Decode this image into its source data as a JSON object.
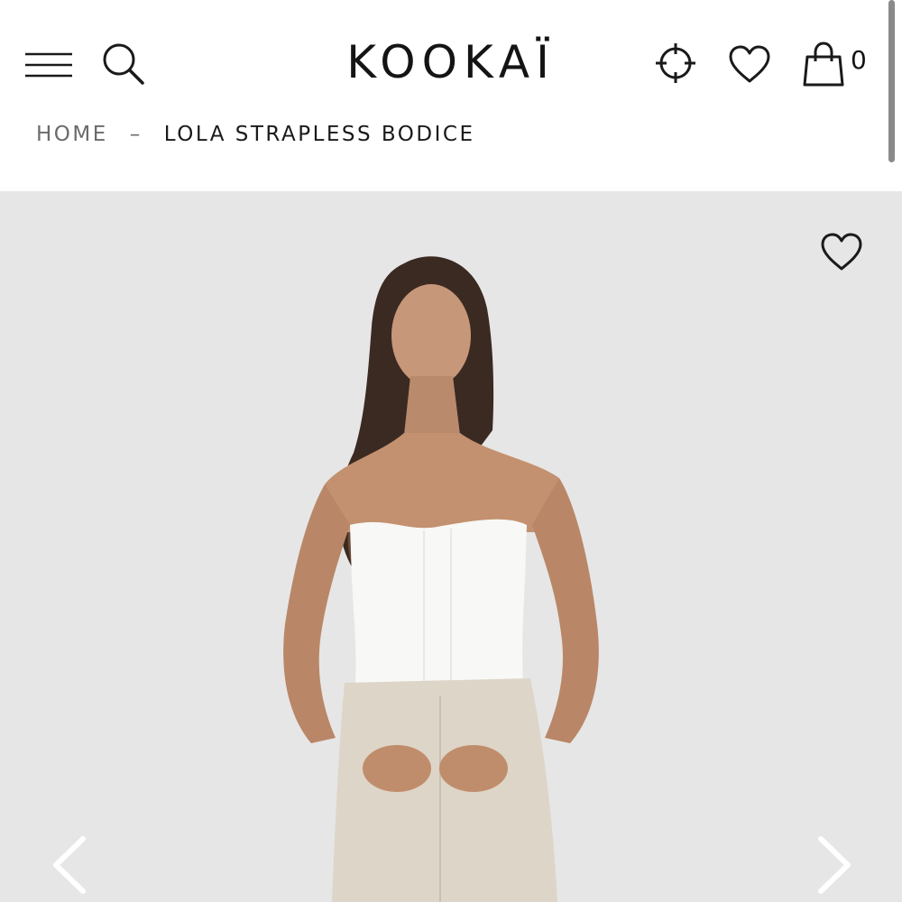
{
  "header": {
    "menu_icon": "hamburger-menu-icon",
    "search_icon": "search-icon",
    "logo": "KOOKAÏ",
    "store_locator_icon": "crosshair-locator-icon",
    "wishlist_icon": "heart-icon",
    "cart_icon": "shopping-bag-icon",
    "cart_count": "0"
  },
  "breadcrumb": {
    "home": "HOME",
    "separator": "–",
    "current": "LOLA STRAPLESS BODICE"
  },
  "gallery": {
    "wishlist_icon": "heart-outline-icon",
    "prev_icon": "chevron-left-icon",
    "next_icon": "chevron-right-icon",
    "image_alt": "Model wearing the Lola Strapless Bodice in white with linen trousers"
  },
  "colors": {
    "text": "#1a1a1a",
    "muted": "#6b6b6b",
    "photo_background": "#e6e6e6",
    "bodice": "#f8f8f6",
    "trousers": "#ddd5c7"
  }
}
